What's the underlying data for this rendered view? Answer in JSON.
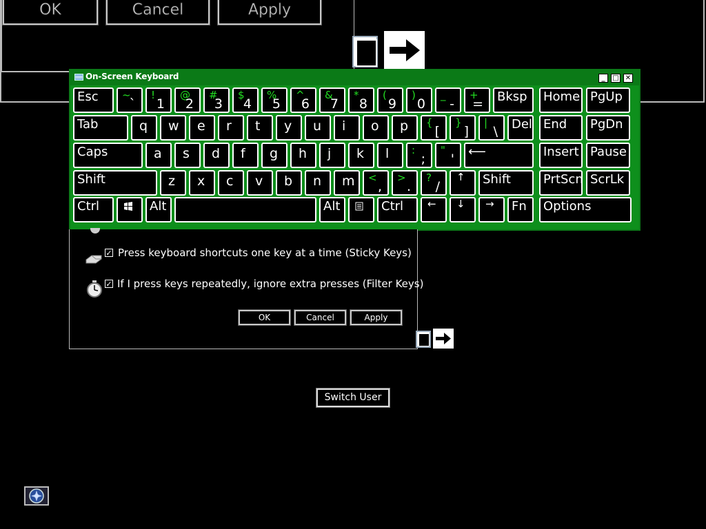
{
  "background_dialog": {
    "ok_label": "OK",
    "cancel_label": "Cancel",
    "apply_label": "Apply"
  },
  "osk": {
    "title": "On-Screen Keyboard",
    "window_controls": [
      "_",
      "□",
      "✕"
    ],
    "rows": [
      [
        {
          "type": "label",
          "text": "Esc"
        },
        {
          "type": "dual",
          "shift": "~",
          "main": "`"
        },
        {
          "type": "dual",
          "shift": "!",
          "main": "1"
        },
        {
          "type": "dual",
          "shift": "@",
          "main": "2"
        },
        {
          "type": "dual",
          "shift": "#",
          "main": "3"
        },
        {
          "type": "dual",
          "shift": "$",
          "main": "4"
        },
        {
          "type": "dual",
          "shift": "%",
          "main": "5"
        },
        {
          "type": "dual",
          "shift": "^",
          "main": "6"
        },
        {
          "type": "dual",
          "shift": "&",
          "main": "7"
        },
        {
          "type": "dual",
          "shift": "*",
          "main": "8"
        },
        {
          "type": "dual",
          "shift": "(",
          "main": "9"
        },
        {
          "type": "dual",
          "shift": ")",
          "main": "0"
        },
        {
          "type": "dual",
          "shift": "_",
          "main": "-"
        },
        {
          "type": "dual",
          "shift": "+",
          "main": "="
        },
        {
          "type": "label",
          "text": "Bksp"
        },
        {
          "type": "label",
          "text": "Home"
        },
        {
          "type": "label",
          "text": "PgUp"
        }
      ],
      [
        {
          "type": "label",
          "text": "Tab"
        },
        {
          "type": "letter",
          "text": "q"
        },
        {
          "type": "letter",
          "text": "w"
        },
        {
          "type": "letter",
          "text": "e"
        },
        {
          "type": "letter",
          "text": "r"
        },
        {
          "type": "letter",
          "text": "t"
        },
        {
          "type": "letter",
          "text": "y"
        },
        {
          "type": "letter",
          "text": "u"
        },
        {
          "type": "letter",
          "text": "i"
        },
        {
          "type": "letter",
          "text": "o"
        },
        {
          "type": "letter",
          "text": "p"
        },
        {
          "type": "dual",
          "shift": "{",
          "main": "["
        },
        {
          "type": "dual",
          "shift": "}",
          "main": "]"
        },
        {
          "type": "dual",
          "shift": "|",
          "main": "\\"
        },
        {
          "type": "label",
          "text": "Del"
        },
        {
          "type": "label",
          "text": "End"
        },
        {
          "type": "label",
          "text": "PgDn"
        }
      ],
      [
        {
          "type": "label",
          "text": "Caps"
        },
        {
          "type": "letter",
          "text": "a"
        },
        {
          "type": "letter",
          "text": "s"
        },
        {
          "type": "letter",
          "text": "d"
        },
        {
          "type": "letter",
          "text": "f"
        },
        {
          "type": "letter",
          "text": "g"
        },
        {
          "type": "letter",
          "text": "h"
        },
        {
          "type": "letter",
          "text": "j"
        },
        {
          "type": "letter",
          "text": "k"
        },
        {
          "type": "letter",
          "text": "l"
        },
        {
          "type": "dual",
          "shift": ":",
          "main": ";"
        },
        {
          "type": "dual",
          "shift": "\"",
          "main": "'"
        },
        {
          "type": "label",
          "text": "⟵"
        },
        {
          "type": "label",
          "text": "Insert"
        },
        {
          "type": "label",
          "text": "Pause"
        }
      ],
      [
        {
          "type": "label",
          "text": "Shift"
        },
        {
          "type": "letter",
          "text": "z"
        },
        {
          "type": "letter",
          "text": "x"
        },
        {
          "type": "letter",
          "text": "c"
        },
        {
          "type": "letter",
          "text": "v"
        },
        {
          "type": "letter",
          "text": "b"
        },
        {
          "type": "letter",
          "text": "n"
        },
        {
          "type": "letter",
          "text": "m"
        },
        {
          "type": "dual",
          "shift": "<",
          "main": ","
        },
        {
          "type": "dual",
          "shift": ">",
          "main": "."
        },
        {
          "type": "dual",
          "shift": "?",
          "main": "/"
        },
        {
          "type": "arrow",
          "text": "↑"
        },
        {
          "type": "label",
          "text": "Shift"
        },
        {
          "type": "label",
          "text": "PrtScn"
        },
        {
          "type": "label",
          "text": "ScrLk"
        }
      ],
      [
        {
          "type": "label",
          "text": "Ctrl"
        },
        {
          "type": "icon",
          "icon": "windows-logo-icon"
        },
        {
          "type": "label",
          "text": "Alt"
        },
        {
          "type": "label",
          "text": ""
        },
        {
          "type": "label",
          "text": "Alt"
        },
        {
          "type": "icon",
          "icon": "menu-key-icon"
        },
        {
          "type": "label",
          "text": "Ctrl"
        },
        {
          "type": "arrow",
          "text": "←"
        },
        {
          "type": "arrow",
          "text": "↓"
        },
        {
          "type": "arrow",
          "text": "→"
        },
        {
          "type": "label",
          "text": "Fn"
        },
        {
          "type": "label",
          "text": "Options"
        }
      ]
    ]
  },
  "ease_dialog": {
    "options": [
      {
        "checked": true,
        "label": "Press keyboard shortcuts one key at a time (Sticky Keys)",
        "icon": "sticky-keys-icon"
      },
      {
        "checked": true,
        "label": "If I press keys repeatedly, ignore extra presses (Filter Keys)",
        "icon": "stopwatch-icon"
      }
    ],
    "ok_label": "OK",
    "cancel_label": "Cancel",
    "apply_label": "Apply"
  },
  "login": {
    "switch_user_label": "Switch User",
    "ease_of_access_icon": "ease-of-access-icon"
  },
  "colors": {
    "osk_frame": "#0b7a17",
    "shift_char": "#22dd22",
    "background": "#000000"
  }
}
